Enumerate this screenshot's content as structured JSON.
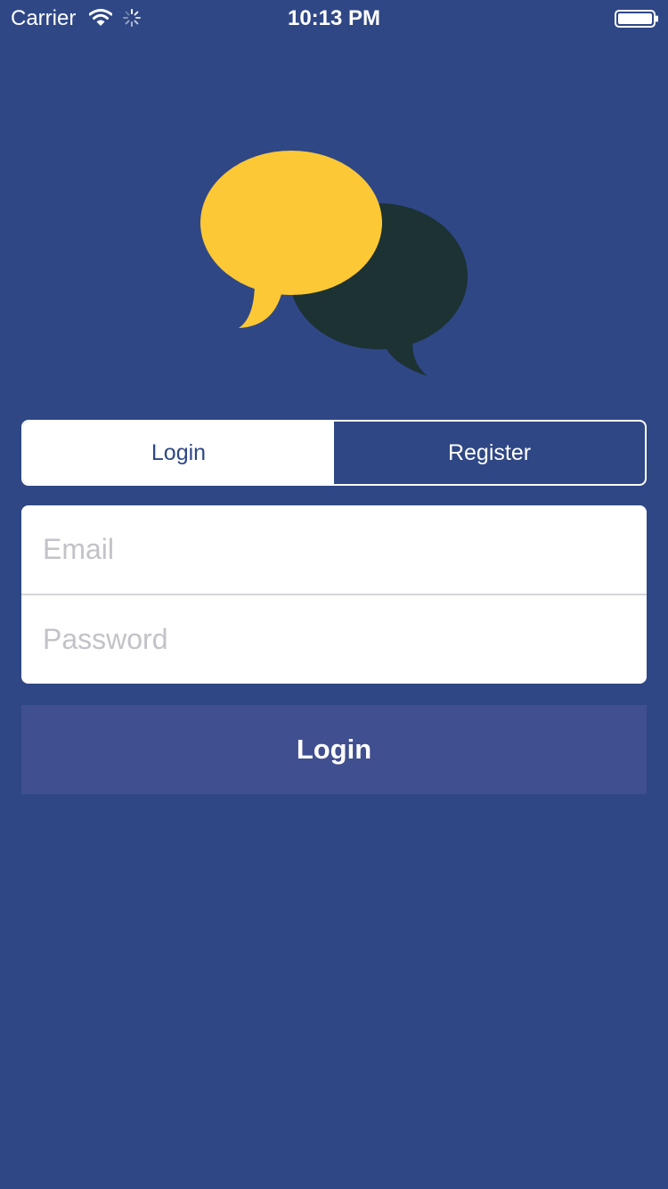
{
  "status_bar": {
    "carrier": "Carrier",
    "time": "10:13 PM",
    "icons": [
      "wifi-icon",
      "spinner-icon",
      "battery-icon"
    ]
  },
  "logo": {
    "icon": "chat-bubbles-icon",
    "colors": {
      "front_bubble": "#fdc836",
      "back_bubble": "#1c3233"
    }
  },
  "tabs": [
    {
      "label": "Login",
      "selected": true
    },
    {
      "label": "Register",
      "selected": false
    }
  ],
  "form": {
    "email": {
      "value": "",
      "placeholder": "Email"
    },
    "password": {
      "value": "",
      "placeholder": "Password"
    }
  },
  "submit": {
    "label": "Login"
  },
  "colors": {
    "background": "#2f4785",
    "button": "#404f8f",
    "tab_selected_bg": "#ffffff",
    "tab_selected_text": "#2f4785",
    "placeholder": "#c2c2c8"
  }
}
